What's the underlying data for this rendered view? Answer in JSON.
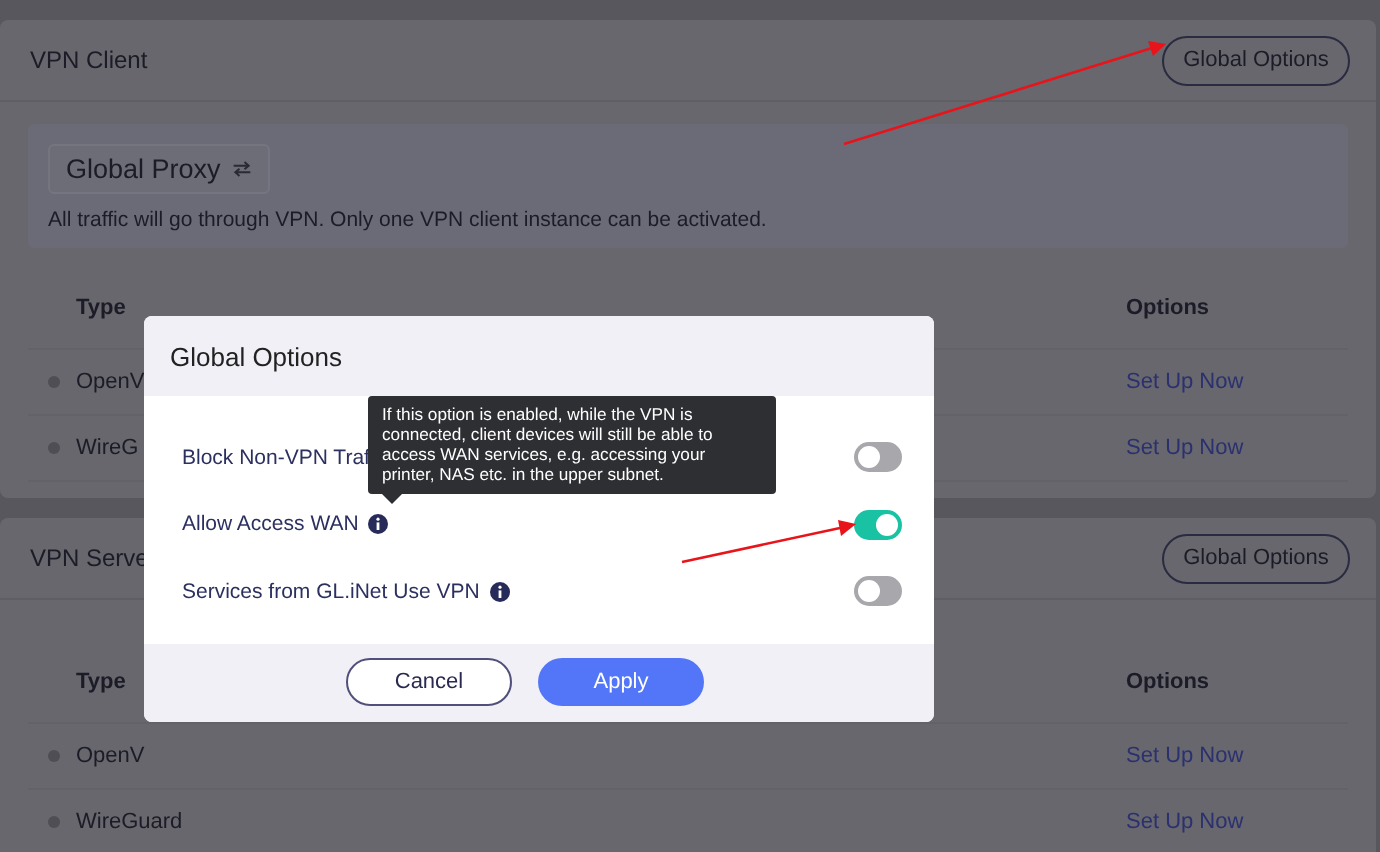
{
  "vpn_client": {
    "title": "VPN Client",
    "button": "Global Options",
    "proxy": {
      "label": "Global Proxy",
      "description": "All traffic will go through VPN. Only one VPN client instance can be activated."
    },
    "columns": [
      "Type",
      "Options"
    ],
    "rows": [
      {
        "type": "OpenV",
        "action": "Set Up Now"
      },
      {
        "type": "WireG",
        "action": "Set Up Now"
      }
    ]
  },
  "vpn_server": {
    "title": "VPN Serve",
    "button": "Global Options",
    "columns": [
      "Type",
      "Options"
    ],
    "rows": [
      {
        "type": "OpenV",
        "action": "Set Up Now"
      },
      {
        "type": "WireGuard",
        "action": "Set Up Now"
      }
    ]
  },
  "dialog": {
    "title": "Global Options",
    "tooltip": "If this option is enabled, while the VPN is connected, client devices will still be able to access WAN services, e.g. accessing your printer, NAS etc. in the upper subnet.",
    "options": [
      {
        "label": "Block Non-VPN Traf",
        "info": false,
        "on": false
      },
      {
        "label": "Allow Access WAN",
        "info": true,
        "on": true
      },
      {
        "label": "Services from GL.iNet Use VPN",
        "info": true,
        "on": false
      }
    ],
    "buttons": [
      {
        "label": "Cancel",
        "kind": "secondary"
      },
      {
        "label": "Apply",
        "kind": "primary"
      }
    ]
  }
}
